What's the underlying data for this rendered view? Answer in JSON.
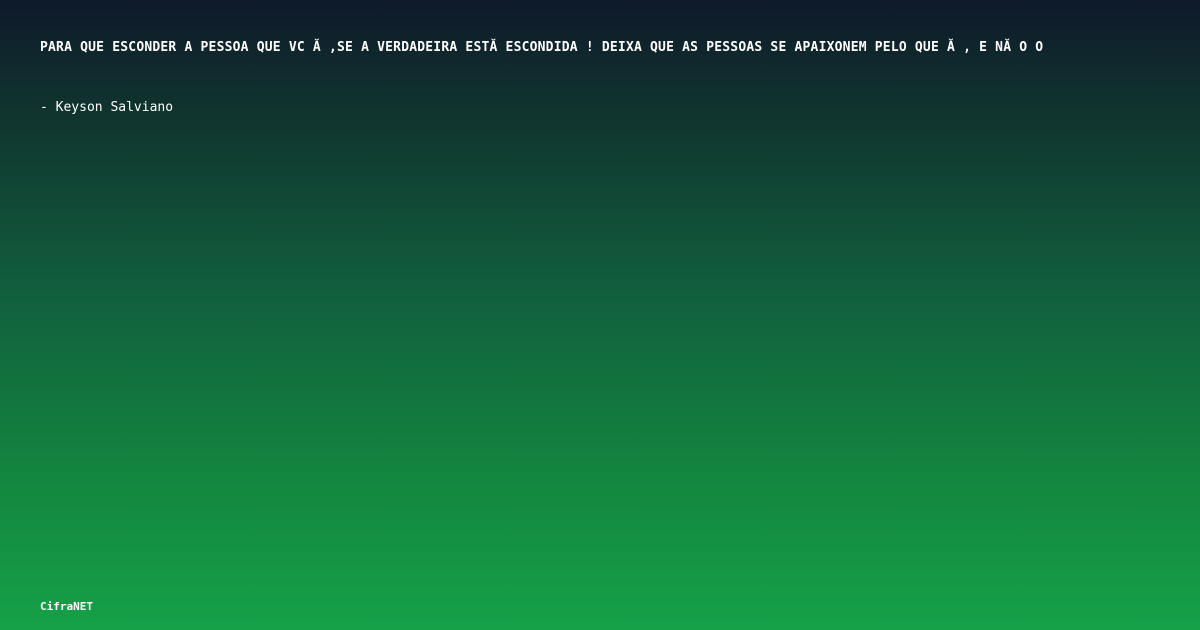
{
  "quote": {
    "text": "PARA QUE ESCONDER A PESSOA QUE VC Ă ,SE A VERDADEIRA ESTĂ ESCONDIDA ! DEIXA QUE AS PESSOAS SE APAIXONEM PELO QUE Ă , E NĂ O O"
  },
  "author": {
    "text": "- Keyson Salviano"
  },
  "brand": {
    "text": "CifraNET"
  }
}
